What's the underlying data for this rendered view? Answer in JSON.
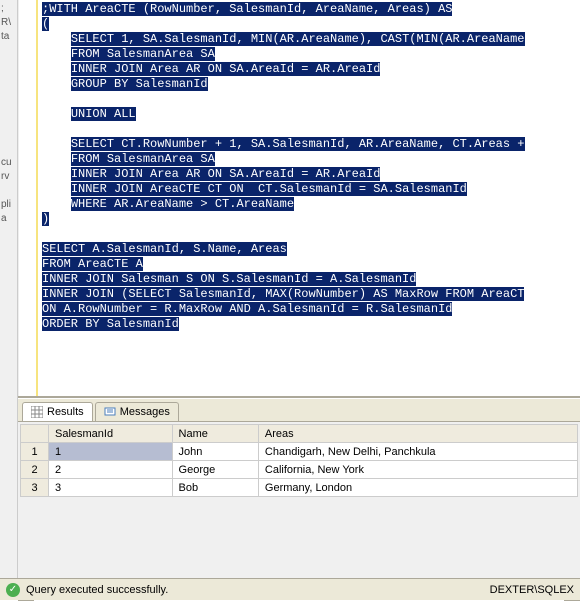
{
  "gutter_fragments": [
    ";",
    "R\\",
    "ta",
    "",
    "",
    "",
    "",
    "",
    "",
    "",
    "",
    "cu",
    "rv",
    "",
    "pli",
    "a"
  ],
  "sql_lines": [
    ";WITH AreaCTE (RowNumber, SalesmanId, AreaName, Areas) AS",
    "(",
    "    SELECT 1, SA.SalesmanId, MIN(AR.AreaName), CAST(MIN(AR.AreaName",
    "    FROM SalesmanArea SA",
    "    INNER JOIN Area AR ON SA.AreaId = AR.AreaId",
    "    GROUP BY SalesmanId",
    "",
    "    UNION ALL",
    "",
    "    SELECT CT.RowNumber + 1, SA.SalesmanId, AR.AreaName, CT.Areas +",
    "    FROM SalesmanArea SA",
    "    INNER JOIN Area AR ON SA.AreaId = AR.AreaId",
    "    INNER JOIN AreaCTE CT ON  CT.SalesmanId = SA.SalesmanId",
    "    WHERE AR.AreaName > CT.AreaName",
    ")",
    "",
    "SELECT A.SalesmanId, S.Name, Areas",
    "FROM AreaCTE A",
    "INNER JOIN Salesman S ON S.SalesmanId = A.SalesmanId",
    "INNER JOIN (SELECT SalesmanId, MAX(RowNumber) AS MaxRow FROM AreaCT",
    "ON A.RowNumber = R.MaxRow AND A.SalesmanId = R.SalesmanId",
    "ORDER BY SalesmanId"
  ],
  "tabs": {
    "results": "Results",
    "messages": "Messages"
  },
  "grid": {
    "headers": [
      "SalesmanId",
      "Name",
      "Areas"
    ],
    "rows": [
      {
        "n": "1",
        "cells": [
          "1",
          "John",
          "Chandigarh, New Delhi, Panchkula"
        ]
      },
      {
        "n": "2",
        "cells": [
          "2",
          "George",
          "California, New York"
        ]
      },
      {
        "n": "3",
        "cells": [
          "3",
          "Bob",
          "Germany, London"
        ]
      }
    ]
  },
  "status": {
    "message": "Query executed successfully.",
    "server": "DEXTER\\SQLEX"
  }
}
